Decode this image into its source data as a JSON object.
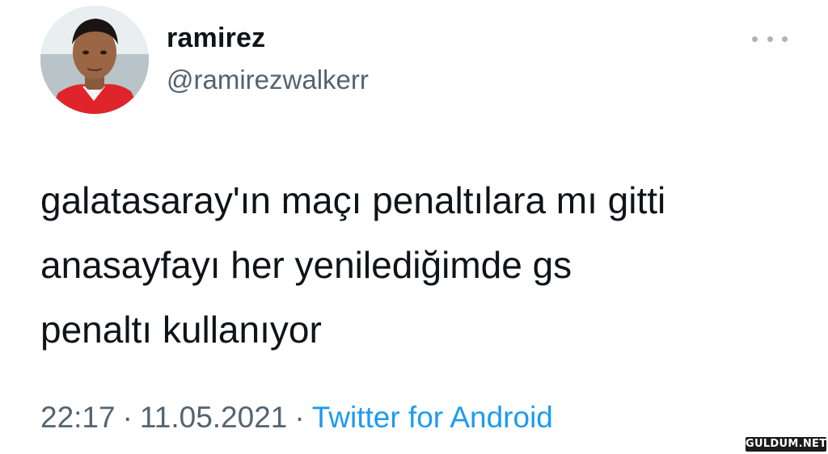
{
  "user": {
    "display_name": "ramirez",
    "handle": "@ramirezwalkerr"
  },
  "tweet": {
    "lines": [
      "galatasaray'ın maçı penaltılara mı gitti",
      "anasayfayı her yenilediğimde gs",
      "penaltı kullanıyor"
    ],
    "time": "22:17",
    "date": "11.05.2021",
    "separator": "·",
    "source": "Twitter for Android"
  },
  "watermark": "GULDUM.NET",
  "icons": {
    "more": "more-horizontal-icon",
    "avatar": "profile-photo"
  },
  "colors": {
    "text": "#0f1419",
    "secondary": "#536471",
    "link": "#1d9bf0",
    "more_dots": "#a9b4bd"
  }
}
